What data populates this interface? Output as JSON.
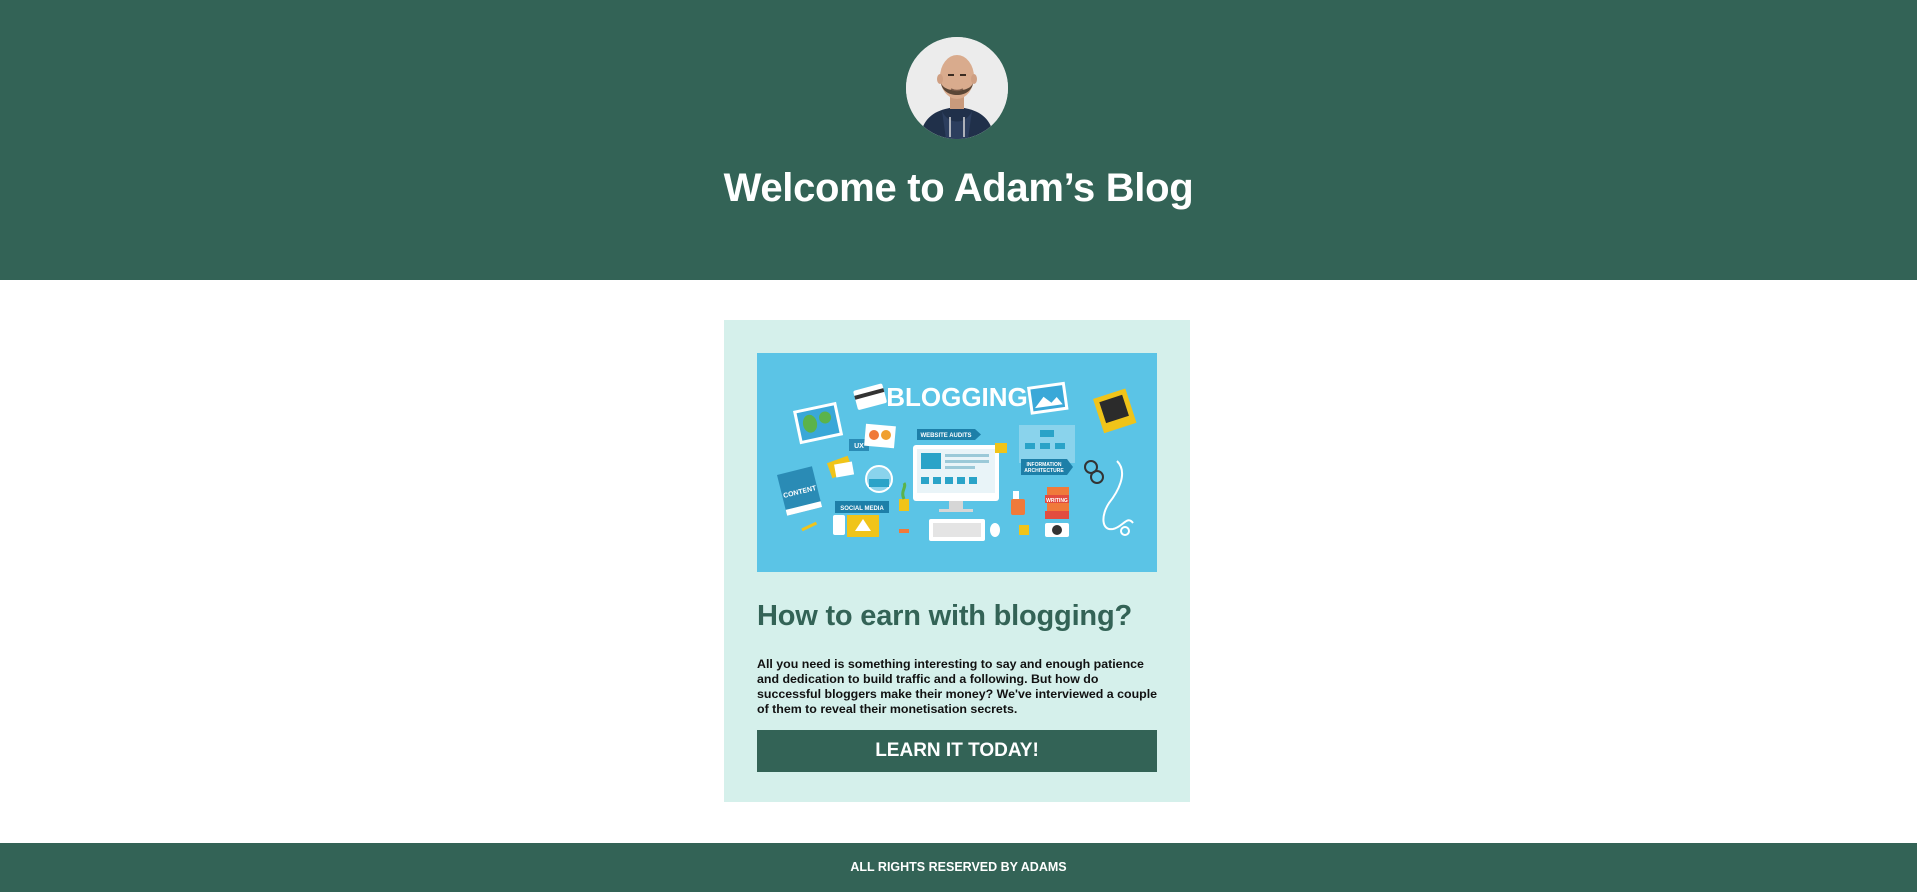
{
  "colors": {
    "primary": "#336356",
    "card_background": "#d5f0eb",
    "image_background": "#5bc4e6",
    "text_on_primary": "#ffffff",
    "body_text": "#111111"
  },
  "header": {
    "avatar_icon": "person-portrait",
    "title": "Welcome to Adam’s Blog"
  },
  "post": {
    "image_text": "BLOGGING",
    "image_labels": [
      "UX",
      "WEBSITE AUDITS",
      "INFORMATION ARCHITECTURE",
      "CONTENT",
      "SOCIAL MEDIA",
      "WRITING"
    ],
    "title": "How to earn with blogging?",
    "excerpt": "All you need is something interesting to say and enough patience and dedication to build traffic and a following. But how do successful bloggers make their money? We've interviewed a couple of them to reveal their monetisation secrets.",
    "cta_label": "LEARN IT TODAY!"
  },
  "footer": {
    "text": "ALL RIGHTS RESERVED BY ADAMS"
  }
}
